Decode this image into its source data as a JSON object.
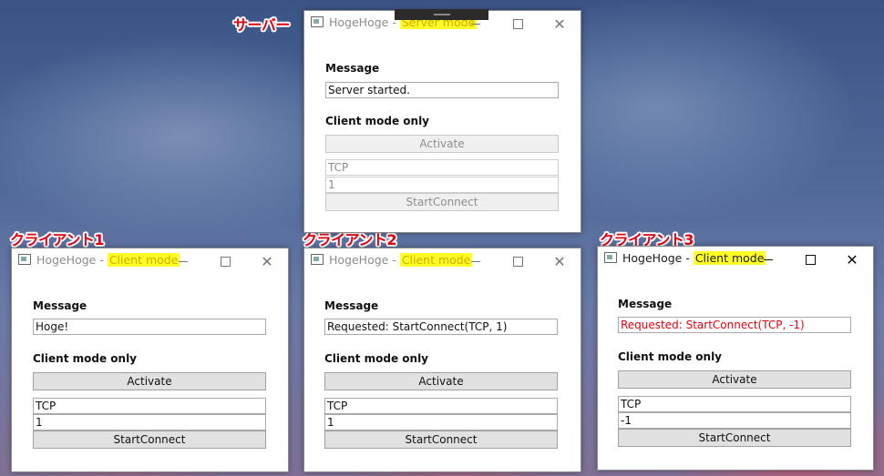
{
  "captions": {
    "server": "サーバー",
    "client1": "クライアント1",
    "client2": "クライアント2",
    "client3": "クライアント3"
  },
  "labels": {
    "message": "Message",
    "client_only": "Client mode only",
    "activate": "Activate",
    "start_connect": "StartConnect"
  },
  "windows": {
    "server": {
      "app_name": "HogeHoge - ",
      "mode": "Server mode",
      "message": "Server started.",
      "protocol": "TCP",
      "port": "1"
    },
    "client1": {
      "app_name": "HogeHoge - ",
      "mode": "Client mode",
      "message": "Hoge!",
      "protocol": "TCP",
      "port": "1"
    },
    "client2": {
      "app_name": "HogeHoge - ",
      "mode": "Client mode",
      "message": "Requested: StartConnect(TCP, 1)",
      "protocol": "TCP",
      "port": "1"
    },
    "client3": {
      "app_name": "HogeHoge - ",
      "mode": "Client mode",
      "message": "Requested: StartConnect(TCP, -1)",
      "protocol": "TCP",
      "port": "-1"
    }
  },
  "colors": {
    "caption": "#e60012",
    "highlight": "#ffff26",
    "error_text": "#e60012"
  }
}
